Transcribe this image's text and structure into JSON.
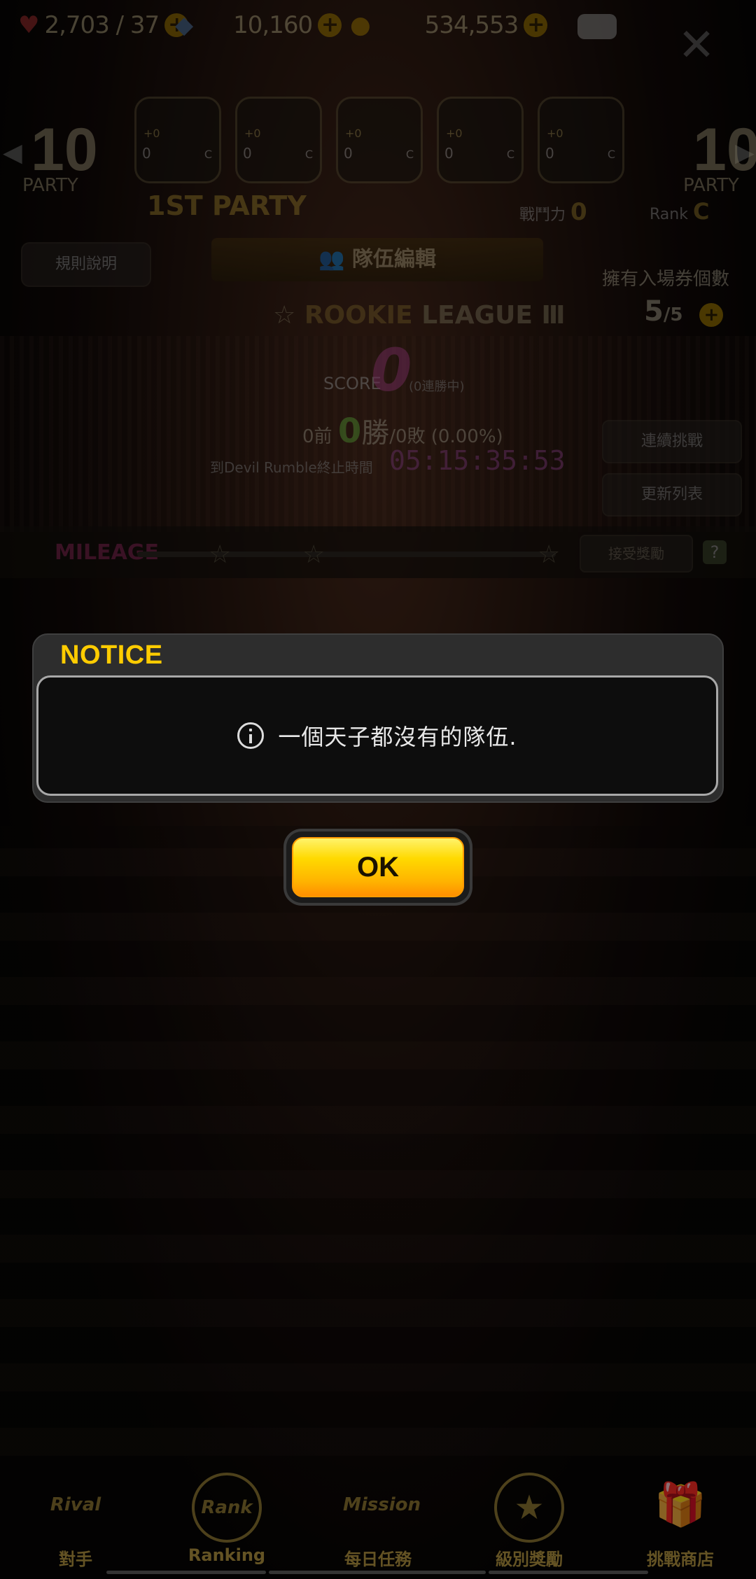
{
  "top_bar": {
    "stamina": "2,703 / 37",
    "gems": "10,160",
    "coins": "534,553",
    "plus_symbol": "+",
    "chat_icon": "chat-bubble-icon",
    "close_icon": "close-icon"
  },
  "party": {
    "left_number": "10",
    "left_label": "PARTY",
    "right_number": "10",
    "right_label": "PARTY",
    "slots": [
      {
        "plus": "+0",
        "level": "0",
        "class": "C"
      },
      {
        "plus": "+0",
        "level": "0",
        "class": "C"
      },
      {
        "plus": "+0",
        "level": "0",
        "class": "C"
      },
      {
        "plus": "+0",
        "level": "0",
        "class": "C"
      },
      {
        "plus": "+0",
        "level": "0",
        "class": "C"
      }
    ],
    "title": "1ST PARTY",
    "power_label": "戰鬥力",
    "power_value": "0",
    "rank_label": "Rank",
    "rank_value": "C"
  },
  "panel": {
    "rules_button": "規則說明",
    "team_edit_button": "隊伍編輯",
    "tickets_label": "擁有入場券個數",
    "tickets_value": "5",
    "tickets_max": "/5",
    "league_rank": "ROOKIE",
    "league_name": "LEAGUE Ⅲ",
    "score_label": "SCORE",
    "score_value": "0",
    "streak": "(0連勝中)",
    "record_prefix": "0前",
    "record_wins": "0",
    "record_win_label": "勝",
    "record_rest": "/0敗 (0.00%)",
    "end_time_label": "到Devil Rumble終止時間",
    "timer": "05:15:35:53",
    "continuous_button": "連續挑戰",
    "refresh_button": "更新列表"
  },
  "mileage": {
    "label": "MILEAGE",
    "progress": 0,
    "claim_button": "接受獎勵",
    "help": "?"
  },
  "dialog": {
    "title": "NOTICE",
    "message": "一個天子都沒有的隊伍.",
    "ok_label": "OK"
  },
  "bottom_nav": {
    "items": [
      {
        "icon_text": "Rival",
        "label": "對手"
      },
      {
        "icon_text": "Rank",
        "label": "Ranking"
      },
      {
        "icon_text": "Mission",
        "label": "每日任務"
      },
      {
        "icon_text": "★",
        "label": "級別獎勵"
      },
      {
        "icon_text": "🎁",
        "label": "挑戰商店"
      }
    ]
  },
  "colors": {
    "notice_title": "#ffcc00",
    "ok_button": "#ffc800",
    "modal_border": "#a8a8a8"
  }
}
